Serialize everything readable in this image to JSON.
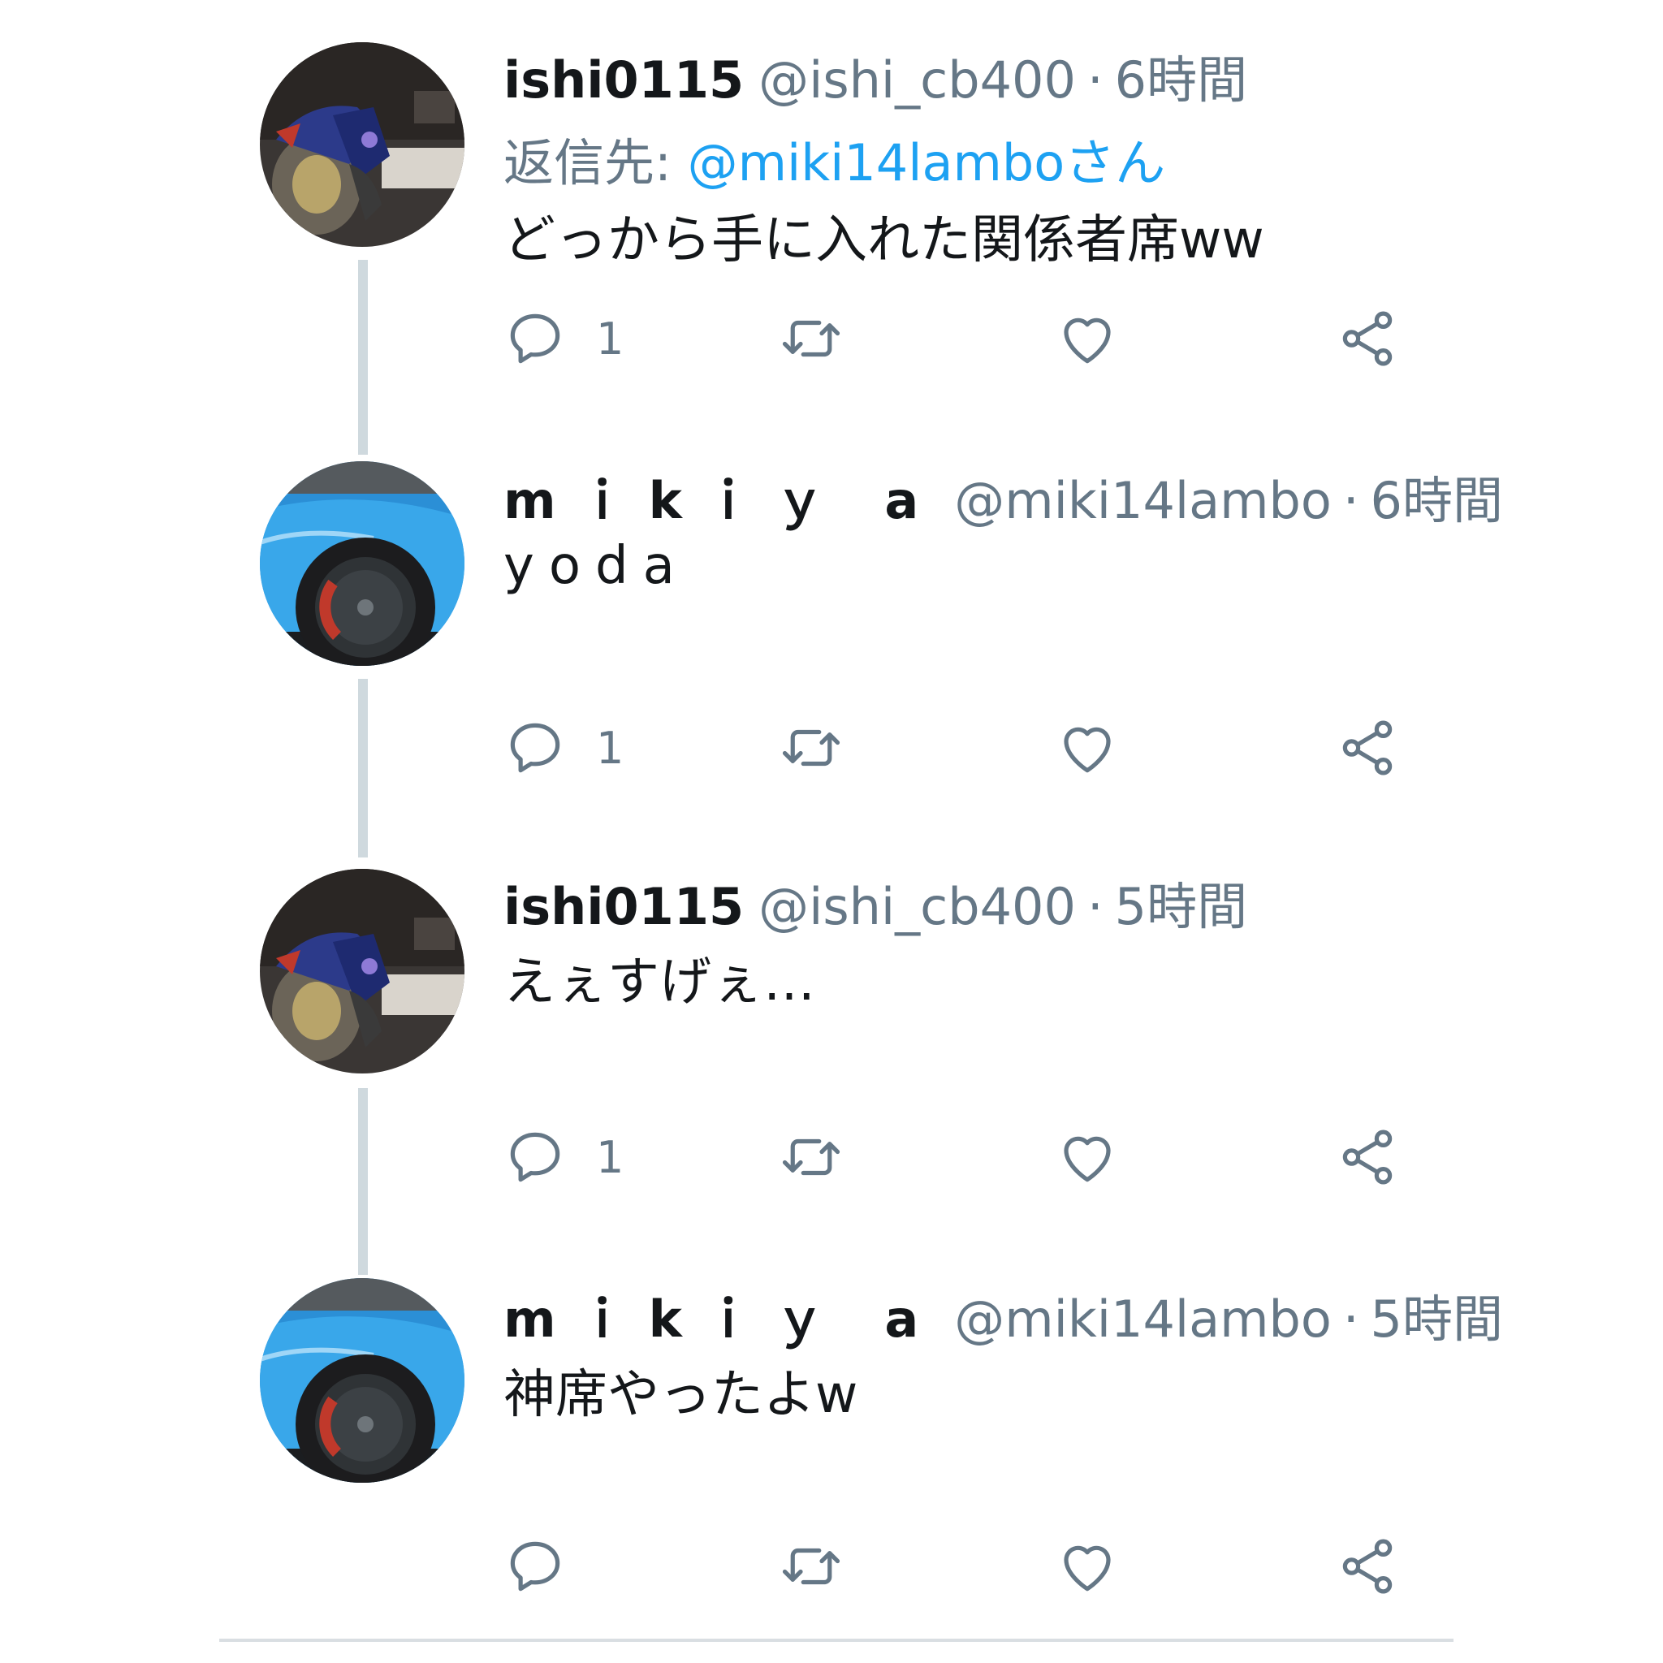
{
  "tweets": [
    {
      "display_name": "ishi0115",
      "handle": "@ishi_cb400",
      "separator": "·",
      "time": "6時間",
      "reply_to_label": "返信先:",
      "reply_to_mention": "@miki14lamboさん",
      "text": "どっから手に入れた関係者席ww",
      "reply_count": "1",
      "avatar": "motorcycle-photo"
    },
    {
      "display_name": "mｉkｉｙ a",
      "handle": "@miki14lambo",
      "separator": "·",
      "time": "6時間",
      "text": "yoda",
      "reply_count": "1",
      "avatar": "blue-car-wheel-photo"
    },
    {
      "display_name": "ishi0115",
      "handle": "@ishi_cb400",
      "separator": "·",
      "time": "5時間",
      "text": "えぇすげぇ…",
      "reply_count": "1",
      "avatar": "motorcycle-photo"
    },
    {
      "display_name": "mｉkｉｙ a",
      "handle": "@miki14lambo",
      "separator": "·",
      "time": "5時間",
      "text": "神席やったよw",
      "reply_count": "",
      "avatar": "blue-car-wheel-photo"
    }
  ],
  "icons": [
    "reply-icon",
    "retweet-icon",
    "like-icon",
    "share-icon"
  ],
  "colors": {
    "text": "#14171a",
    "secondary": "#657786",
    "link": "#1da1f2",
    "thread_line": "#cfd9de"
  }
}
